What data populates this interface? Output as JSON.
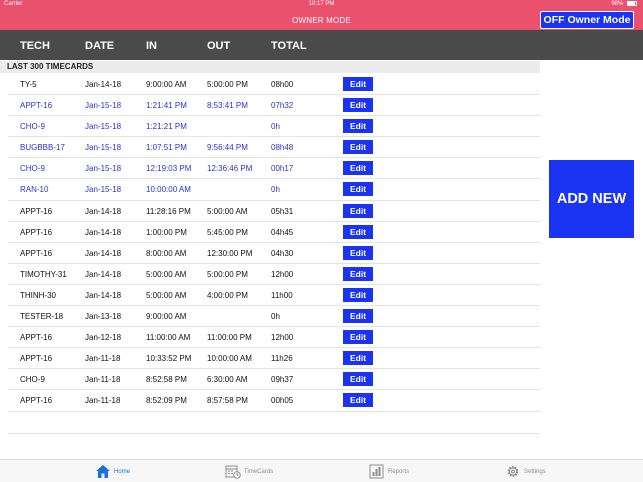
{
  "status_bar": {
    "carrier": "Carrier",
    "time": "10:17 PM",
    "battery": "98%"
  },
  "nav": {
    "title": "OWNER MODE",
    "owner_button": "OFF Owner Mode"
  },
  "colors": {
    "nav_bar": "#e9516c",
    "button_blue": "#1b33f2",
    "header_dark": "#4a4a4a",
    "blue_row_text": "#2a33d6",
    "active_tab": "#1b6fe0"
  },
  "table": {
    "columns": [
      "TECH",
      "DATE",
      "IN",
      "OUT",
      "TOTAL"
    ],
    "section_title": "LAST 300 TIMECARDS",
    "edit_label": "Edit",
    "rows": [
      {
        "tech": "TY-5",
        "date": "Jan-14-18",
        "in": "9:00:00 AM",
        "out": "5:00:00 PM",
        "total": "08h00",
        "highlight": false
      },
      {
        "tech": "APPT-16",
        "date": "Jan-15-18",
        "in": "1:21:41 PM",
        "out": "8:53:41 PM",
        "total": "07h32",
        "highlight": true
      },
      {
        "tech": "CHO-9",
        "date": "Jan-15-18",
        "in": "1:21:21 PM",
        "out": "",
        "total": "0h",
        "highlight": true
      },
      {
        "tech": "BUGBBB-17",
        "date": "Jan-15-18",
        "in": "1:07:51 PM",
        "out": "9:56:44 PM",
        "total": "08h48",
        "highlight": true
      },
      {
        "tech": "CHO-9",
        "date": "Jan-15-18",
        "in": "12:19:03 PM",
        "out": "12:36:46 PM",
        "total": "00h17",
        "highlight": true
      },
      {
        "tech": "RAN-10",
        "date": "Jan-15-18",
        "in": "10:00:00 AM",
        "out": "",
        "total": "0h",
        "highlight": true
      },
      {
        "tech": "APPT-16",
        "date": "Jan-14-18",
        "in": "11:28:16 PM",
        "out": "5:00:00 AM",
        "total": "05h31",
        "highlight": false
      },
      {
        "tech": "APPT-16",
        "date": "Jan-14-18",
        "in": "1:00:00 PM",
        "out": "5:45:00 PM",
        "total": "04h45",
        "highlight": false
      },
      {
        "tech": "APPT-16",
        "date": "Jan-14-18",
        "in": "8:00:00 AM",
        "out": "12:30:00 PM",
        "total": "04h30",
        "highlight": false
      },
      {
        "tech": "TIMOTHY-31",
        "date": "Jan-14-18",
        "in": "5:00:00 AM",
        "out": "5:00:00 PM",
        "total": "12h00",
        "highlight": false
      },
      {
        "tech": "THINH-30",
        "date": "Jan-14-18",
        "in": "5:00:00 AM",
        "out": "4:00:00 PM",
        "total": "11h00",
        "highlight": false
      },
      {
        "tech": "TESTER-18",
        "date": "Jan-13-18",
        "in": "9:00:00 AM",
        "out": "",
        "total": "0h",
        "highlight": false
      },
      {
        "tech": "APPT-16",
        "date": "Jan-12-18",
        "in": "11:00:00 AM",
        "out": "11:00:00 PM",
        "total": "12h00",
        "highlight": false
      },
      {
        "tech": "APPT-16",
        "date": "Jan-11-18",
        "in": "10:33:52 PM",
        "out": "10:00:00 AM",
        "total": "11h26",
        "highlight": false
      },
      {
        "tech": "CHO-9",
        "date": "Jan-11-18",
        "in": "8:52:58 PM",
        "out": "6:30:00 AM",
        "total": "09h37",
        "highlight": false
      },
      {
        "tech": "APPT-16",
        "date": "Jan-11-18",
        "in": "8:52:09 PM",
        "out": "8:57:58 PM",
        "total": "00h05",
        "highlight": false
      }
    ]
  },
  "add_new_label": "ADD NEW",
  "tabs": [
    {
      "label": "Home",
      "icon": "home-icon",
      "active": true
    },
    {
      "label": "TimeCards",
      "icon": "calendar-clock-icon",
      "active": false
    },
    {
      "label": "Reports",
      "icon": "reports-icon",
      "active": false
    },
    {
      "label": "Settings",
      "icon": "gear-icon",
      "active": false
    }
  ]
}
